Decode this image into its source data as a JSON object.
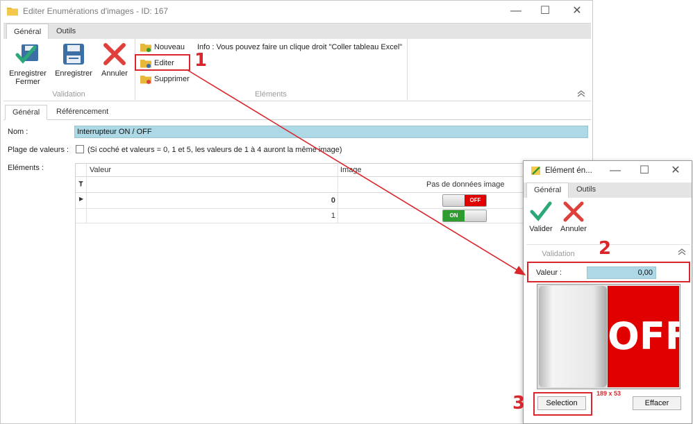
{
  "main_window": {
    "title": "Editer Enumérations d'images - ID: 167",
    "ribbon_tabs": [
      "Général",
      "Outils"
    ],
    "validation_group": {
      "label": "Validation",
      "save_close_line1": "Enregistrer",
      "save_close_line2": "Fermer",
      "save": "Enregistrer",
      "cancel": "Annuler"
    },
    "elements_group": {
      "label": "Eléments",
      "new": "Nouveau",
      "edit": "Editer",
      "delete": "Supprimer",
      "info": "Info : Vous pouvez faire un clique droit \"Coller tableau Excel\""
    },
    "content_tabs": [
      "Général",
      "Référencement"
    ],
    "form": {
      "name_label": "Nom :",
      "name_value": "Interrupteur ON / OFF",
      "range_label": "Plage de valeurs :",
      "range_text": "(Si coché et valeurs = 0, 1 et 5, les valeurs de 1 à 4 auront la même image)",
      "elements_label": "Eléments :"
    },
    "grid": {
      "columns": [
        "Valeur",
        "Image"
      ],
      "no_image_text": "Pas de données image",
      "rows": [
        {
          "value": "0",
          "toggle_text": "OFF",
          "current": true
        },
        {
          "value": "1",
          "toggle_text": "ON",
          "current": false
        }
      ]
    }
  },
  "dialog": {
    "title": "Elément én...",
    "tabs": [
      "Général",
      "Outils"
    ],
    "validate": "Valider",
    "cancel": "Annuler",
    "group_label": "Validation",
    "value_label": "Valeur :",
    "value": "0,00",
    "preview_text": "OFF",
    "image_size": "189 x 53",
    "select_button": "Selection",
    "clear_button": "Effacer"
  },
  "annotations": [
    "1",
    "2",
    "3"
  ],
  "colors": {
    "annotation_red": "#d9252b",
    "field_blue": "#add8e6",
    "off_red": "#e00000",
    "on_green": "#2e9c2e"
  }
}
